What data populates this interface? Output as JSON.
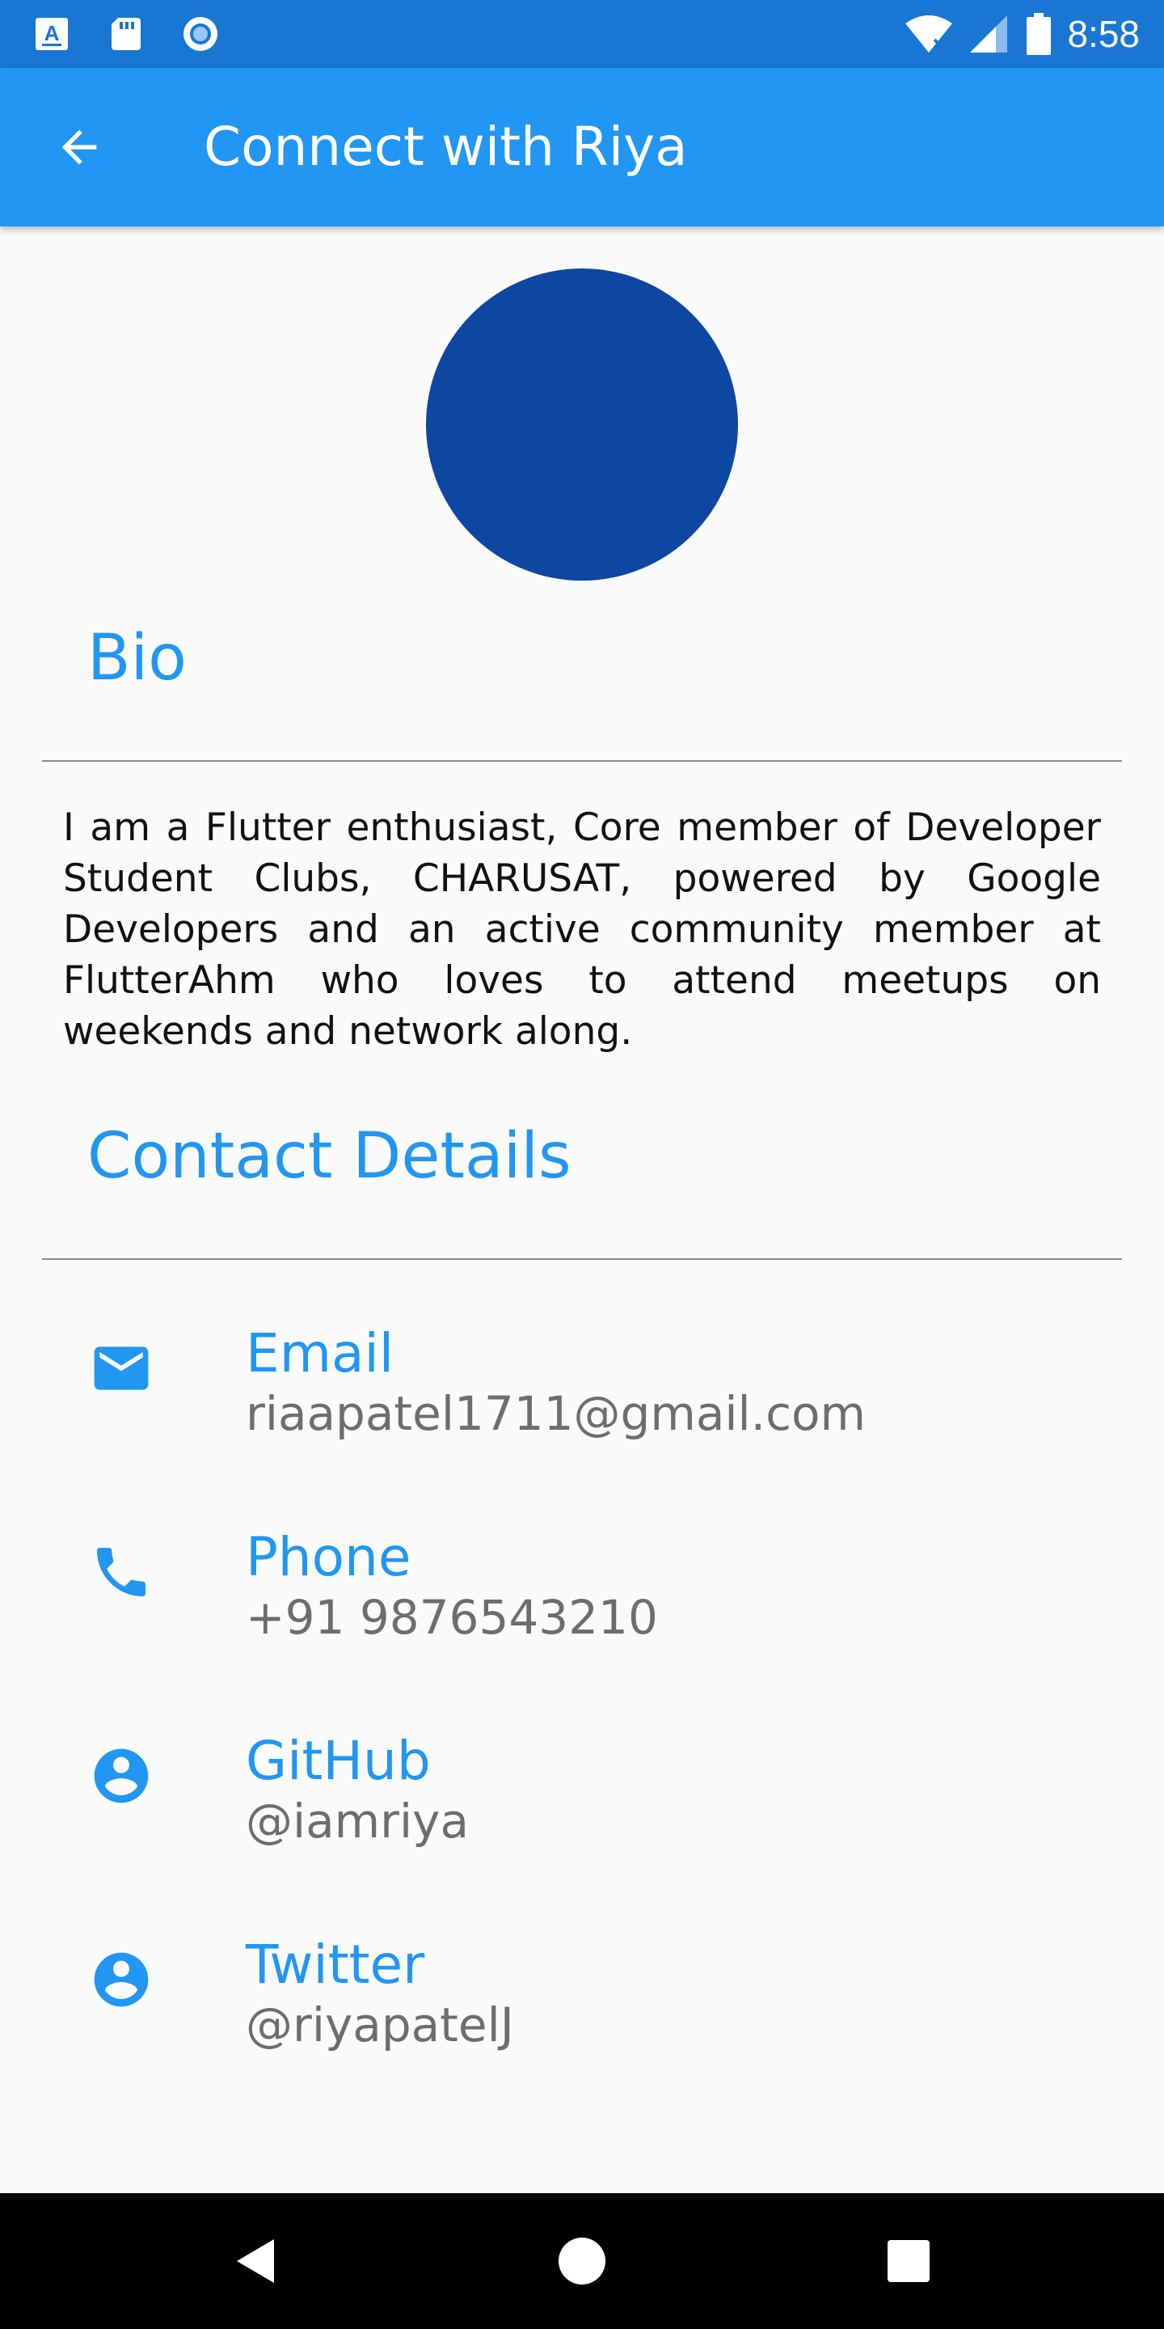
{
  "status_bar": {
    "time": "8:58",
    "icons": [
      "a-keyboard-icon",
      "sd-card-icon",
      "circle-app-icon",
      "wifi-off-icon",
      "cell-signal-icon",
      "battery-icon"
    ]
  },
  "app_bar": {
    "title": "Connect with Riya",
    "back_icon": "arrow-back-icon"
  },
  "profile": {
    "avatar_color": "#0d47a1"
  },
  "bio": {
    "heading": "Bio",
    "text": "I am a Flutter enthusiast, Core member of Developer Student Clubs, CHARUSAT, powered by Google Developers and an active community member at FlutterAhm who loves to attend meetups on weekends and network along."
  },
  "contact": {
    "heading": "Contact Details",
    "items": [
      {
        "label": "Email",
        "value": "riaapatel1711@gmail.com",
        "icon": "mail-icon"
      },
      {
        "label": "Phone",
        "value": "+91 9876543210",
        "icon": "phone-icon"
      },
      {
        "label": "GitHub",
        "value": "@iamriya",
        "icon": "account-circle-icon"
      },
      {
        "label": "Twitter",
        "value": "@riyapatelJ",
        "icon": "account-circle-icon"
      }
    ]
  },
  "colors": {
    "status_bar": "#1976d2",
    "app_bar": "#2196f3",
    "accent": "#2196f3",
    "secondary_text": "#6d6d6d",
    "background": "#fafafa"
  },
  "nav_bar": {
    "buttons": [
      "back-triangle-icon",
      "home-circle-icon",
      "recents-square-icon"
    ]
  }
}
